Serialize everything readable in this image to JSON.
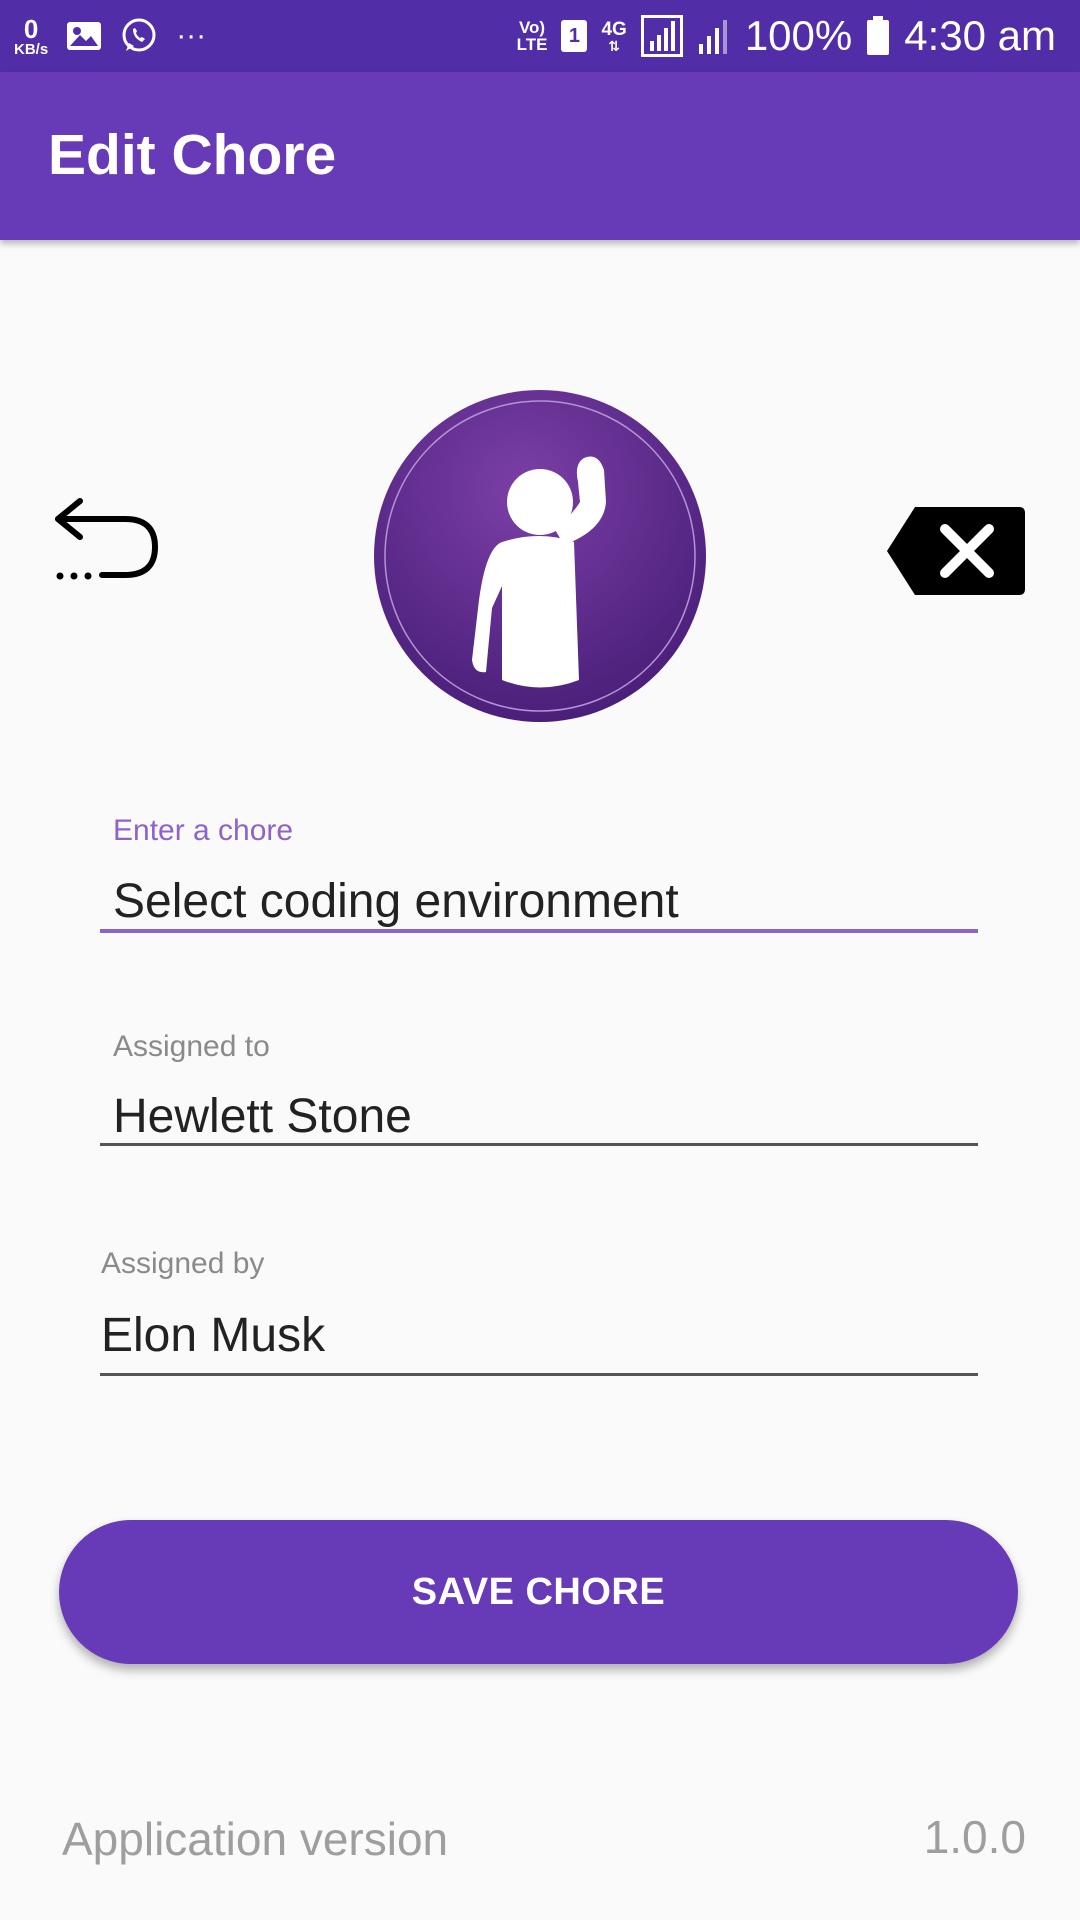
{
  "status_bar": {
    "kb_value": "0",
    "kb_unit": "KB/s",
    "more": "···",
    "volte_top": "Vo)",
    "volte_bottom": "LTE",
    "sim": "1",
    "network": "4G",
    "battery": "100%",
    "time": "4:30 am"
  },
  "app_bar": {
    "title": "Edit Chore"
  },
  "icons": {
    "undo": "undo-arrow-icon",
    "avatar": "person-raising-hand-icon",
    "clear": "backspace-clear-icon"
  },
  "form": {
    "chore": {
      "label": "Enter a chore",
      "value": "Select coding environment"
    },
    "assigned_to": {
      "label": "Assigned to",
      "value": "Hewlett Stone"
    },
    "assigned_by": {
      "label": "Assigned by",
      "value": "Elon Musk"
    }
  },
  "save_button": {
    "label": "SAVE CHORE"
  },
  "footer": {
    "label": "Application version",
    "value": "1.0.0"
  },
  "colors": {
    "status_bar": "#512da8",
    "primary": "#673ab7",
    "focus_label": "#8e63c9",
    "avatar_dark": "#4a1f7a",
    "avatar_light": "#7b3fa6"
  }
}
